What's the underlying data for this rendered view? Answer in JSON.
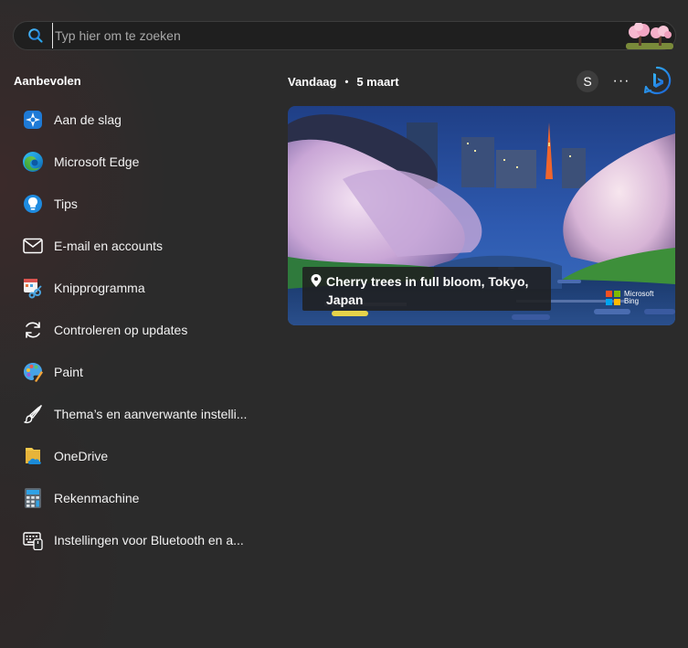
{
  "search": {
    "placeholder": "Typ hier om te zoeken"
  },
  "recommended": {
    "title": "Aanbevolen",
    "items": [
      {
        "label": "Aan de slag",
        "icon": "get-started-icon"
      },
      {
        "label": "Microsoft Edge",
        "icon": "edge-icon"
      },
      {
        "label": "Tips",
        "icon": "tips-icon"
      },
      {
        "label": "E-mail en accounts",
        "icon": "mail-icon"
      },
      {
        "label": "Knipprogramma",
        "icon": "snipping-tool-icon"
      },
      {
        "label": "Controleren op updates",
        "icon": "refresh-icon"
      },
      {
        "label": "Paint",
        "icon": "paint-icon"
      },
      {
        "label": "Thema’s en aanverwante instelli...",
        "icon": "brush-icon"
      },
      {
        "label": "OneDrive",
        "icon": "onedrive-icon"
      },
      {
        "label": "Rekenmachine",
        "icon": "calculator-icon"
      },
      {
        "label": "Instellingen voor Bluetooth en a...",
        "icon": "bluetooth-settings-icon"
      }
    ]
  },
  "today": {
    "label": "Vandaag",
    "separator": "•",
    "date": "5 maart"
  },
  "account": {
    "initial": "S"
  },
  "more": {
    "label": "···"
  },
  "picture": {
    "caption": "Cherry trees in full bloom, Tokyo, Japan",
    "brand_line1": "Microsoft",
    "brand_line2": "Bing"
  },
  "colors": {
    "background": "#2b2b2b",
    "search_bg": "#1f1f1f",
    "accent_blue": "#1a8cd8"
  }
}
